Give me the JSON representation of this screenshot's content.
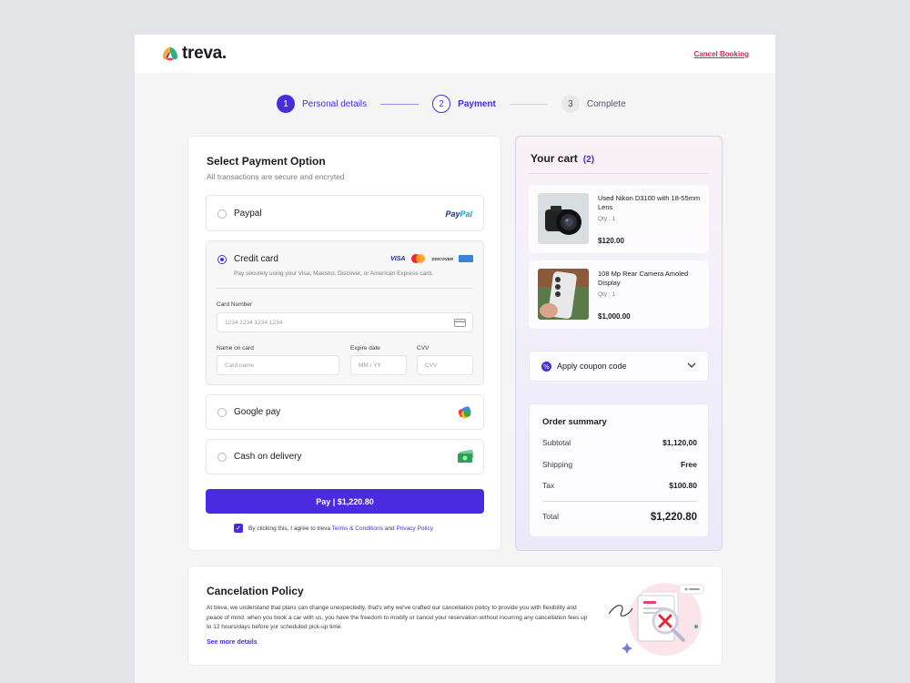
{
  "brand": {
    "name": "treva."
  },
  "header": {
    "cancel_label": "Cancel Booking"
  },
  "stepper": [
    {
      "num": "1",
      "label": "Personal details"
    },
    {
      "num": "2",
      "label": "Payment"
    },
    {
      "num": "3",
      "label": "Complete"
    }
  ],
  "payment": {
    "title": "Select Payment Option",
    "subtitle": "All transactions are secure and encryted",
    "options": {
      "paypal": "Paypal",
      "credit": "Credit card",
      "credit_desc": "Pay securely using your Visa, Maestro, Discover, or American Express card.",
      "google": "Google pay",
      "cash": "Cash on delivery"
    },
    "selected": "credit",
    "brands": {
      "visa": "VISA",
      "discover": "DISCOVER",
      "paypal_a": "Pay",
      "paypal_b": "Pal"
    },
    "fields": {
      "card_number_label": "Card Number",
      "card_number_placeholder": "1234 1234 1234 1234",
      "name_label": "Name on card",
      "name_placeholder": "Card name",
      "expire_label": "Expire date",
      "expire_placeholder": "MM / YY",
      "cvv_label": "CVV",
      "cvv_placeholder": "CVV"
    },
    "pay_button": "Pay | $1,220.80",
    "agree_text": "By clicking this, I agree to treva ",
    "terms": "Terms & Conditions",
    "and": " and ",
    "privacy": "Privacy Policy"
  },
  "cart": {
    "title": "Your cart",
    "count": "(2)",
    "items": [
      {
        "name": "Used Nikon D3100 with 18-55mm Lens",
        "qty": "Qty : 1",
        "price": "$120.00"
      },
      {
        "name": "108 Mp Rear Camera Amoled Display",
        "qty": "Qty : 1",
        "price": "$1,000.00"
      }
    ],
    "coupon": "Apply coupon code",
    "summary": {
      "title": "Order summary",
      "subtotal_label": "Subtotal",
      "subtotal": "$1,120,00",
      "shipping_label": "Shipping",
      "shipping": "Free",
      "tax_label": "Tax",
      "tax": "$100.80",
      "total_label": "Total",
      "total": "$1,220.80"
    }
  },
  "policy": {
    "title": "Cancelation Policy",
    "text": "At treva, we understand that plans can change unexpectedly. that's why we've crafted our cancellation policy to provide you with flexibility and peace of mind. when you book a car with us, you have the freedom to modify or cancel your reservation without incurring any cancellation fees up to 12 hours/days before yor scheduled pick-up time.",
    "link": "See more details"
  },
  "colors": {
    "accent": "#4a2be0",
    "danger": "#d6205f",
    "background": "#f5f5f6"
  }
}
